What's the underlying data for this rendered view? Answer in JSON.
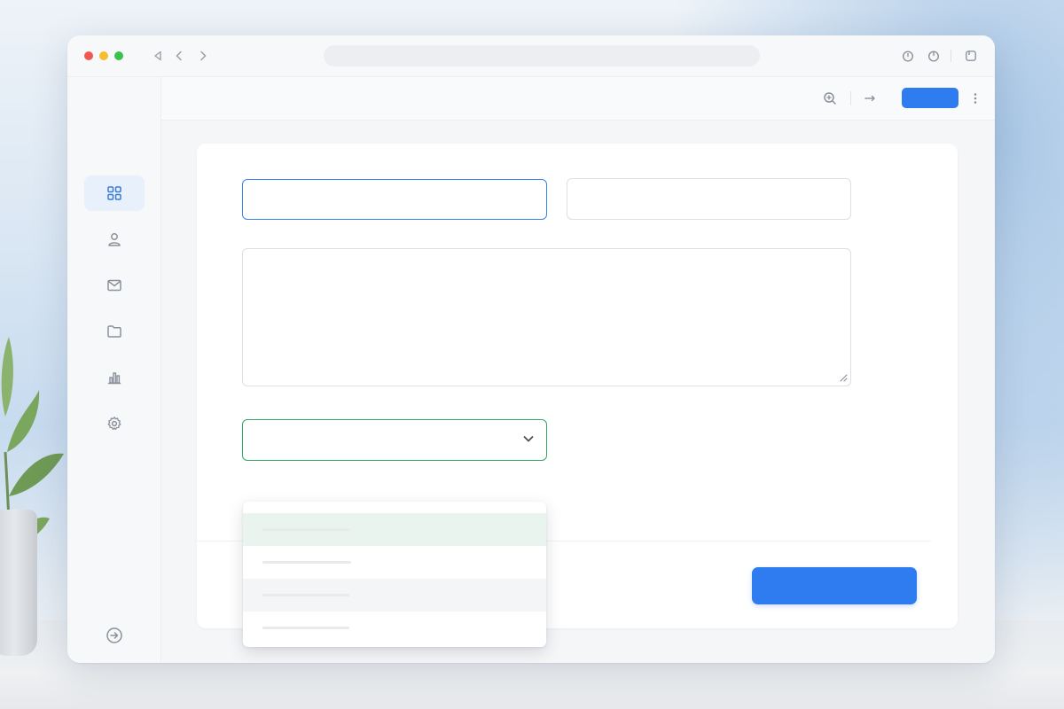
{
  "window": {
    "title": "",
    "url": ""
  },
  "titlebar": {
    "icons": [
      "back-triangle-icon",
      "chevron-left-icon",
      "chevron-right-icon",
      "timer-icon",
      "power-icon",
      "sidebar-toggle-icon"
    ]
  },
  "sidebar": {
    "items": [
      {
        "id": "dashboard",
        "icon": "grid-icon",
        "active": true
      },
      {
        "id": "profile",
        "icon": "user-icon",
        "active": false
      },
      {
        "id": "mail",
        "icon": "mail-icon",
        "active": false
      },
      {
        "id": "files",
        "icon": "folder-icon",
        "active": false
      },
      {
        "id": "analytics",
        "icon": "bar-chart-icon",
        "active": false
      },
      {
        "id": "settings",
        "icon": "gear-icon",
        "active": false
      }
    ],
    "bottom_icon": "logout-icon"
  },
  "topbar": {
    "icons": [
      "zoom-in-icon",
      "arrow-right-icon",
      "more-vertical-icon"
    ],
    "primary_label": ""
  },
  "form": {
    "field1": {
      "value": "",
      "placeholder": ""
    },
    "field2": {
      "value": "",
      "placeholder": ""
    },
    "message": {
      "value": "",
      "placeholder": ""
    },
    "select": {
      "selected": ""
    },
    "dropdown_options": [
      "",
      "",
      "",
      ""
    ],
    "submit_label": ""
  },
  "colors": {
    "accent": "#2e7cf0",
    "focus_border": "#3b82e6",
    "select_border": "#34a867",
    "selected_option_bg": "#eaf4ee"
  }
}
